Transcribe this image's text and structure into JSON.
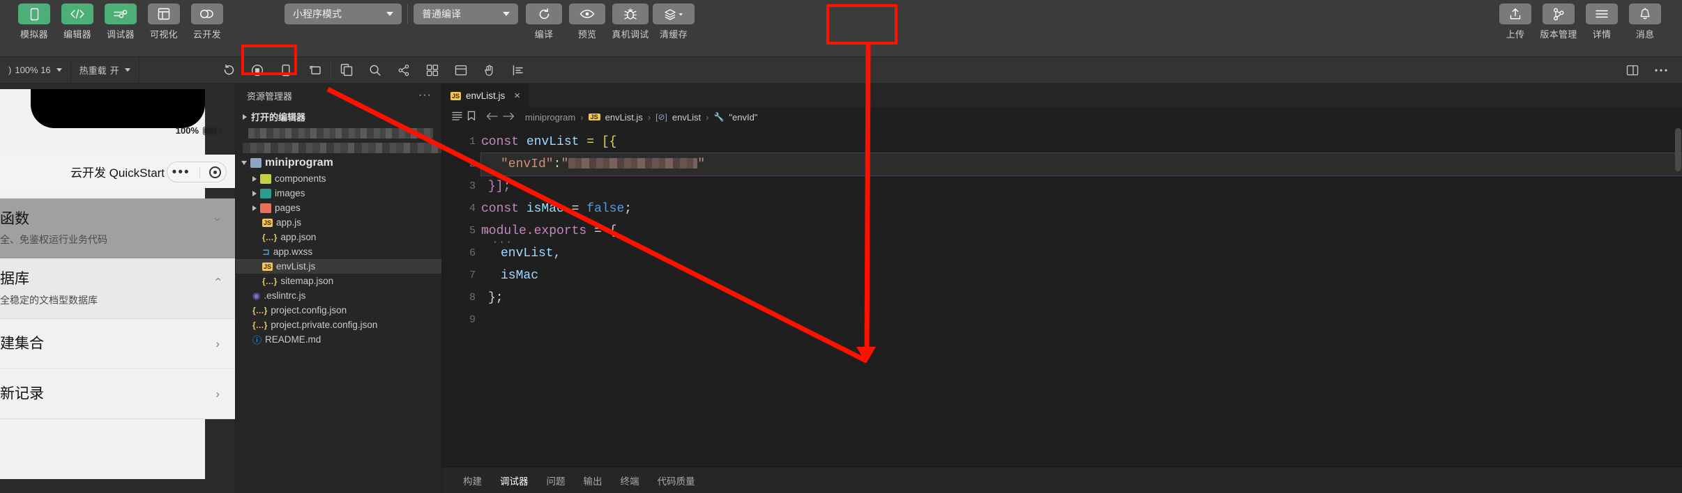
{
  "toolbar": {
    "left_items": [
      {
        "label": "模拟器",
        "icon": "phone-icon",
        "accent": true
      },
      {
        "label": "编辑器",
        "icon": "code-icon",
        "accent": true
      },
      {
        "label": "调试器",
        "icon": "sliders-icon",
        "accent": true
      },
      {
        "label": "可视化",
        "icon": "layout-icon",
        "accent": false
      },
      {
        "label": "云开发",
        "icon": "cloud-icon",
        "accent": false
      }
    ],
    "mode_select": {
      "value": "小程序模式",
      "icon": "chevron-down-icon"
    },
    "compile_select": {
      "value": "普通编译",
      "icon": "chevron-down-icon"
    },
    "actions": [
      {
        "label": "编译",
        "icon": "refresh-icon"
      },
      {
        "label": "预览",
        "icon": "eye-icon"
      },
      {
        "label": "真机调试",
        "icon": "bug-icon"
      },
      {
        "label": "清缓存",
        "icon": "layers-icon",
        "has_caret": true
      }
    ],
    "right_items": [
      {
        "label": "上传",
        "icon": "upload-icon"
      },
      {
        "label": "版本管理",
        "icon": "branch-icon"
      },
      {
        "label": "详情",
        "icon": "menu-icon"
      },
      {
        "label": "消息",
        "icon": "bell-icon"
      }
    ]
  },
  "subbar": {
    "zoom": "100% 16",
    "zoom_prefix": ")",
    "hotreload_label": "热重载",
    "hotreload_value": "开",
    "icons": [
      "refresh-circle-icon",
      "record-icon",
      "device-icon",
      "multi-screen-icon",
      "copy-icon",
      "search-icon",
      "share-icon",
      "grid-icon",
      "panel-icon",
      "hand-icon",
      "align-icon"
    ],
    "right_icons": [
      "split-editor-icon",
      "more-icon"
    ]
  },
  "simulator": {
    "battery_percent": "100%",
    "nav_title": "云开发 QuickStart",
    "capsule": {
      "menu": "•••",
      "target": "target-icon"
    },
    "cards": [
      {
        "title": "函数",
        "subtitle": "全、免鉴权运行业务代码",
        "chevron": "down"
      },
      {
        "title": "据库",
        "subtitle": "全稳定的文档型数据库",
        "chevron": "up"
      },
      {
        "title": "建集合",
        "subtitle": "",
        "chevron": "right"
      },
      {
        "title": "新记录",
        "subtitle": "",
        "chevron": "right"
      }
    ]
  },
  "explorer": {
    "title": "资源管理器",
    "more_icon": "more-icon",
    "open_editors_label": "打开的编辑器",
    "root_label": "miniprogram",
    "tree": [
      {
        "name": "components",
        "kind": "folder-components",
        "depth": 1,
        "expandable": true,
        "selected": false
      },
      {
        "name": "images",
        "kind": "folder-images",
        "depth": 1,
        "expandable": true,
        "selected": false
      },
      {
        "name": "pages",
        "kind": "folder-pages",
        "depth": 1,
        "expandable": true,
        "selected": false
      },
      {
        "name": "app.js",
        "kind": "js",
        "depth": 1,
        "expandable": false,
        "selected": false
      },
      {
        "name": "app.json",
        "kind": "json",
        "depth": 1,
        "expandable": false,
        "selected": false
      },
      {
        "name": "app.wxss",
        "kind": "wxss",
        "depth": 1,
        "expandable": false,
        "selected": false
      },
      {
        "name": "envList.js",
        "kind": "js",
        "depth": 1,
        "expandable": false,
        "selected": true
      },
      {
        "name": "sitemap.json",
        "kind": "json",
        "depth": 1,
        "expandable": false,
        "selected": false
      },
      {
        "name": ".eslintrc.js",
        "kind": "eslint",
        "depth": 0,
        "expandable": false,
        "selected": false
      },
      {
        "name": "project.config.json",
        "kind": "json",
        "depth": 0,
        "expandable": false,
        "selected": false
      },
      {
        "name": "project.private.config.json",
        "kind": "json",
        "depth": 0,
        "expandable": false,
        "selected": false
      },
      {
        "name": "README.md",
        "kind": "md",
        "depth": 0,
        "expandable": false,
        "selected": false
      }
    ]
  },
  "editor": {
    "tab": {
      "label": "envList.js",
      "icon": "js-icon",
      "close": "×"
    },
    "breadcrumb": {
      "menu_icon": "list-icon",
      "bookmark_icon": "bookmark-icon",
      "back_icon": "arrow-left-icon",
      "forward_icon": "arrow-right-icon",
      "parts": [
        "miniprogram",
        "envList.js",
        "envList",
        "\"envId\""
      ],
      "separator": "›"
    },
    "code_lines": [
      {
        "n": "1",
        "fold": "chevron-down"
      },
      {
        "n": "2",
        "fold": ""
      },
      {
        "n": "3",
        "fold": ""
      },
      {
        "n": "4",
        "fold": ""
      },
      {
        "n": "5",
        "fold": "chevron-down"
      },
      {
        "n": "6",
        "fold": ""
      },
      {
        "n": "7",
        "fold": ""
      },
      {
        "n": "8",
        "fold": ""
      },
      {
        "n": "9",
        "fold": ""
      }
    ],
    "code": {
      "l1_kw": "const",
      "l1_var": "envList",
      "l1_eq": "= [{",
      "l2_key": "\"envId\"",
      "l2_colon": ":",
      "l2_quote": "\"",
      "l2_end": "\"",
      "l3": "}];",
      "l4_kw": "const",
      "l4_var": "isMac",
      "l4_eq": "=",
      "l4_val": "false",
      "l4_semi": ";",
      "l5_obj": "module.exports",
      "l5_eq": "= {",
      "l6": "envList,",
      "l7": "isMac",
      "l8": "};"
    }
  },
  "bottom_panel": {
    "tabs": [
      {
        "label": "构建",
        "active": false
      },
      {
        "label": "调试器",
        "active": true
      },
      {
        "label": "问题",
        "active": false
      },
      {
        "label": "输出",
        "active": false
      },
      {
        "label": "终端",
        "active": false
      },
      {
        "label": "代码质量",
        "active": false
      }
    ]
  },
  "annotations": {
    "highlight_color": "#ff1100",
    "boxes": [
      "subbar-refresh-button",
      "clear-cache-button"
    ],
    "arrow": "points from subbar-refresh-button to code-line-2"
  }
}
